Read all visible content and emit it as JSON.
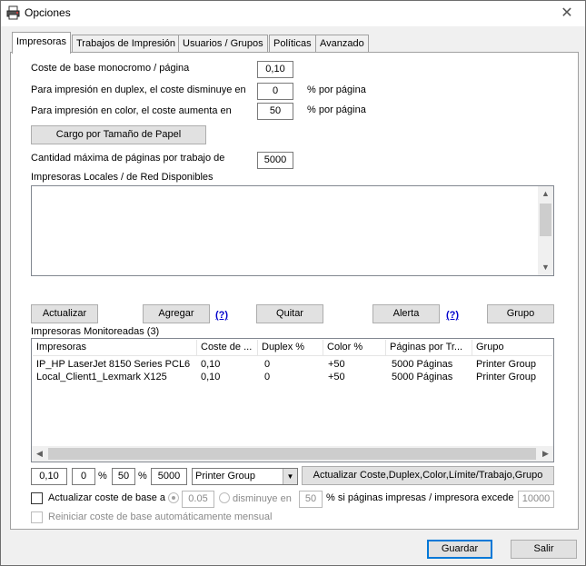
{
  "window": {
    "title": "Opciones"
  },
  "tabs": [
    {
      "label": "Impresoras",
      "active": true
    },
    {
      "label": "Trabajos de Impresión",
      "active": false
    },
    {
      "label": "Usuarios / Grupos",
      "active": false
    },
    {
      "label": "Políticas",
      "active": false
    },
    {
      "label": "Avanzado",
      "active": false
    }
  ],
  "costs": {
    "base_mono_label": "Coste de base monocromo / página",
    "base_mono_value": "0,10",
    "duplex_label": "Para impresión en duplex, el coste disminuye en",
    "duplex_value": "0",
    "duplex_unit": "% por página",
    "color_label": "Para impresión en color, el coste aumenta en",
    "color_value": "50",
    "color_unit": "% por página",
    "paper_size_button": "Cargo por Tamaño de Papel",
    "max_pages_label": "Cantidad máxima de páginas por trabajo de",
    "max_pages_value": "5000"
  },
  "available": {
    "label": "Impresoras Locales / de Red Disponibles"
  },
  "actions": {
    "refresh": "Actualizar",
    "add": "Agregar",
    "help1": "(?)",
    "remove": "Quitar",
    "alert": "Alerta",
    "help2": "(?)",
    "group": "Grupo"
  },
  "monitored": {
    "label": "Impresoras Monitoreadas (3)",
    "columns": [
      "Impresoras",
      "Coste de ...",
      "Duplex %",
      "Color %",
      "Páginas por Tr...",
      "Grupo"
    ],
    "rows": [
      [
        "IP_HP LaserJet 8150 Series PCL6",
        "0,10",
        "0",
        "+50",
        "5000 Páginas",
        "Printer Group"
      ],
      [
        "Local_Client1_Lexmark X125",
        "0,10",
        "0",
        "+50",
        "5000 Páginas",
        "Printer Group"
      ]
    ]
  },
  "edit_row": {
    "cost": "0,10",
    "duplex": "0",
    "pct1": "%",
    "color": "50",
    "pct2": "%",
    "pages": "5000",
    "group_selected": "Printer Group",
    "update_button": "Actualizar Coste,Duplex,Color,Límite/Trabajo,Grupo"
  },
  "auto_update": {
    "label": "Actualizar coste de base a",
    "value": "0.05",
    "decrease_label": "disminuye en",
    "decrease_value": "50",
    "condition_label": "% si páginas impresas / impresora",
    "exceeds_label": "excede",
    "exceeds_value": "10000",
    "reset_label": "Reiniciar coste de base automáticamente mensual"
  },
  "footer": {
    "save": "Guardar",
    "exit": "Salir"
  }
}
